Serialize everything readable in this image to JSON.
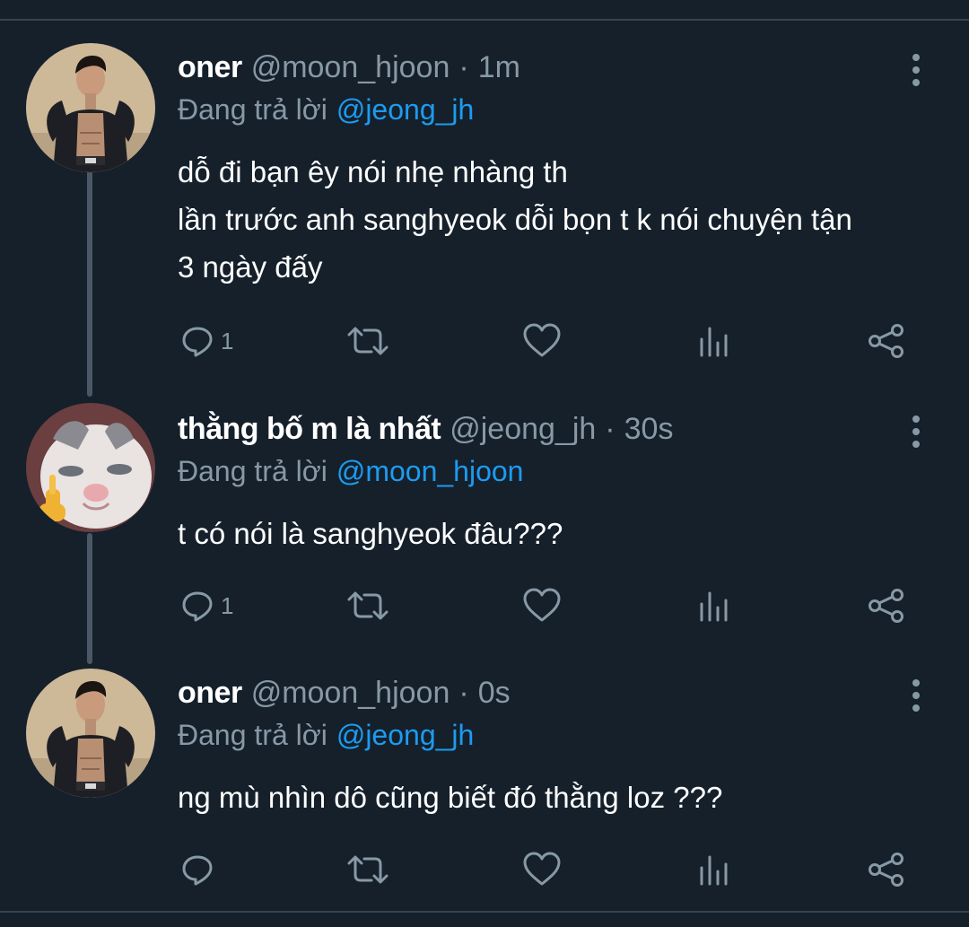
{
  "tweets": [
    {
      "name": "oner",
      "handle": "@moon_hjoon",
      "separator": "·",
      "time": "1m",
      "reply_prefix": "Đang trả lời",
      "reply_to": "@jeong_jh",
      "lines": [
        "dỗ đi bạn êy nói nhẹ nhàng th",
        "lần trước anh sanghyeok dỗi bọn t k nói chuyện tận",
        "3 ngày đấy"
      ],
      "reply_count": "1",
      "avatar": "man-denim-jacket-photo"
    },
    {
      "name": "thằng bố m là nhất",
      "handle": "@jeong_jh",
      "separator": "·",
      "time": "30s",
      "reply_prefix": "Đang trả lời",
      "reply_to": "@moon_hjoon",
      "lines": [
        "t có nói là sanghyeok đâu???"
      ],
      "reply_count": "1",
      "avatar": "cat-middle-finger-photo"
    },
    {
      "name": "oner",
      "handle": "@moon_hjoon",
      "separator": "·",
      "time": "0s",
      "reply_prefix": "Đang trả lời",
      "reply_to": "@jeong_jh",
      "lines": [
        "ng mù nhìn dô cũng biết đó thằng loz ???"
      ],
      "reply_count": "",
      "avatar": "man-denim-jacket-photo"
    }
  ],
  "icons": {
    "reply": "reply-icon",
    "retweet": "retweet-icon",
    "like": "heart-icon",
    "views": "analytics-icon",
    "share": "share-icon",
    "more": "more-vertical-icon"
  },
  "colors": {
    "background": "#15202b",
    "text": "#ffffff",
    "secondary": "#8899a6",
    "accent": "#1d9bf0",
    "divider": "#38444d"
  }
}
